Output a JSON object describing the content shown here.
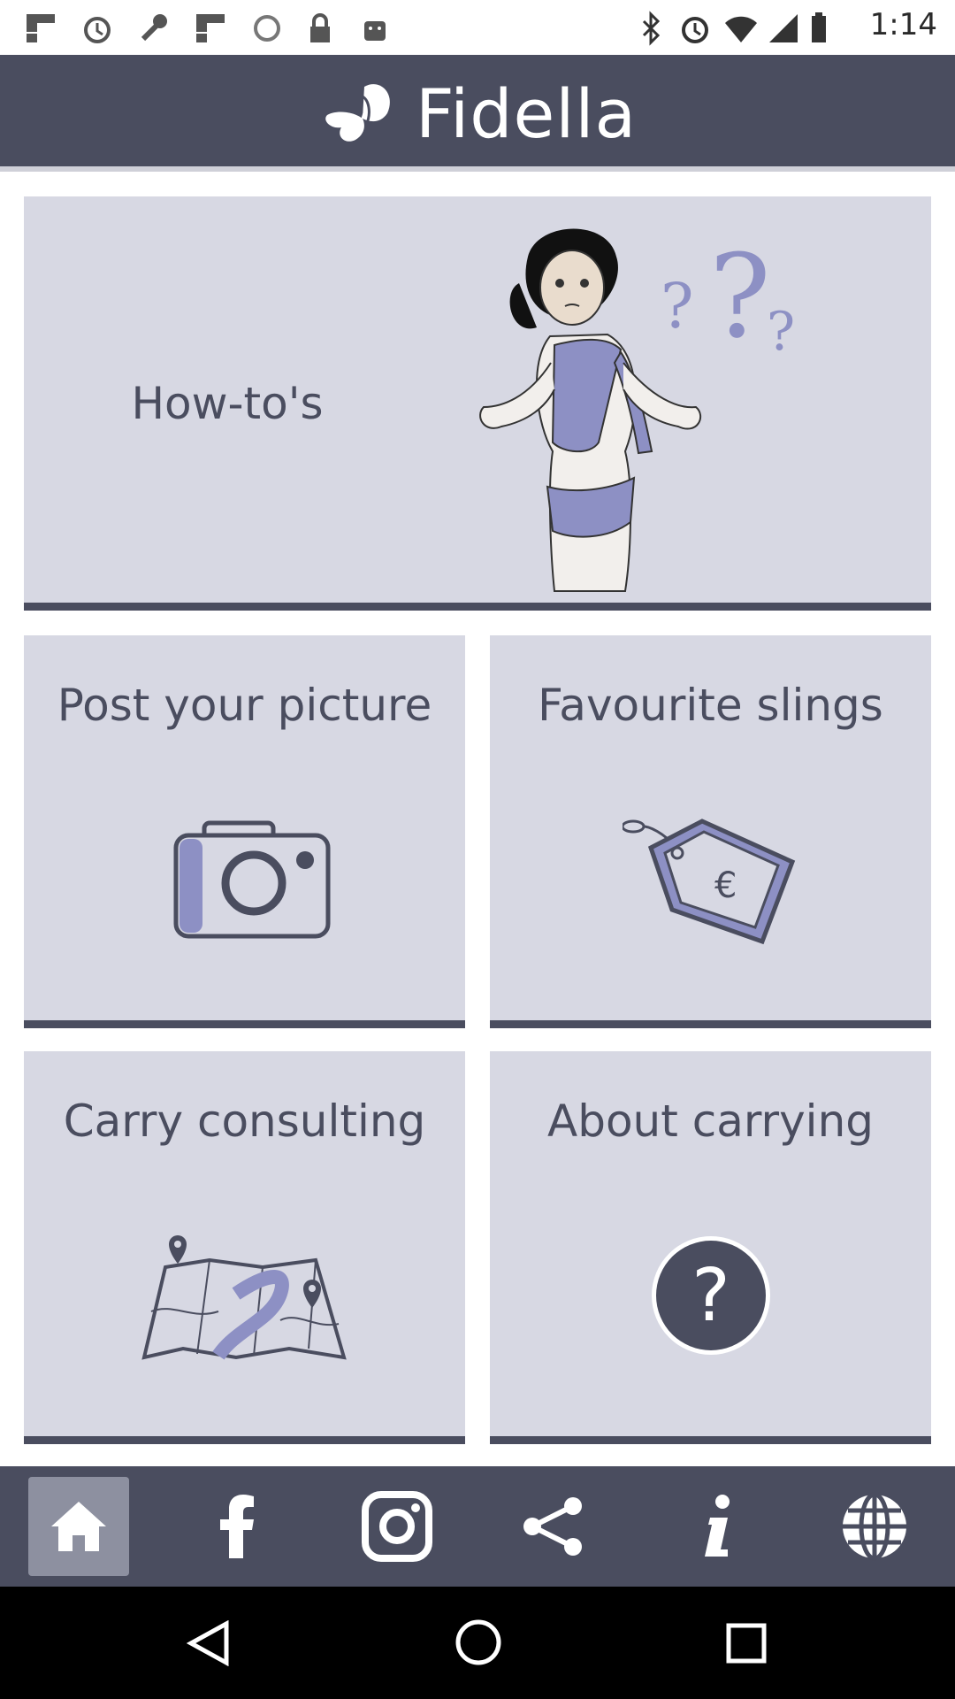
{
  "status_bar": {
    "time": "1:14",
    "left_icons": [
      "flipboard-icon",
      "alarm-icon",
      "wrench-icon",
      "flipboard-icon",
      "sync-icon",
      "lock-icon",
      "android-icon"
    ],
    "right_icons": [
      "bluetooth-icon",
      "alarm-icon",
      "wifi-icon",
      "signal-icon",
      "battery-icon"
    ]
  },
  "header": {
    "title": "Fidella",
    "logo_icon": "butterfly-icon"
  },
  "tiles": {
    "howtos": {
      "label": "How-to's",
      "illustration": "woman-shrugging-illustration"
    },
    "post_picture": {
      "label": "Post your picture",
      "icon": "camera-icon"
    },
    "favourite_slings": {
      "label": "Favourite slings",
      "icon": "price-tag-icon",
      "tag_symbol": "€"
    },
    "carry_consulting": {
      "label": "Carry consulting",
      "icon": "map-icon"
    },
    "about_carrying": {
      "label": "About carrying",
      "icon": "question-circle-icon",
      "symbol": "?"
    }
  },
  "bottom_nav": {
    "items": [
      "home-icon",
      "facebook-icon",
      "instagram-icon",
      "share-icon",
      "info-icon",
      "globe-icon"
    ],
    "active": "home-icon"
  },
  "colors": {
    "header": "#4a4d5f",
    "tile": "#d7d8e3",
    "text": "#4a4d5f",
    "accent": "#8d90c4"
  }
}
